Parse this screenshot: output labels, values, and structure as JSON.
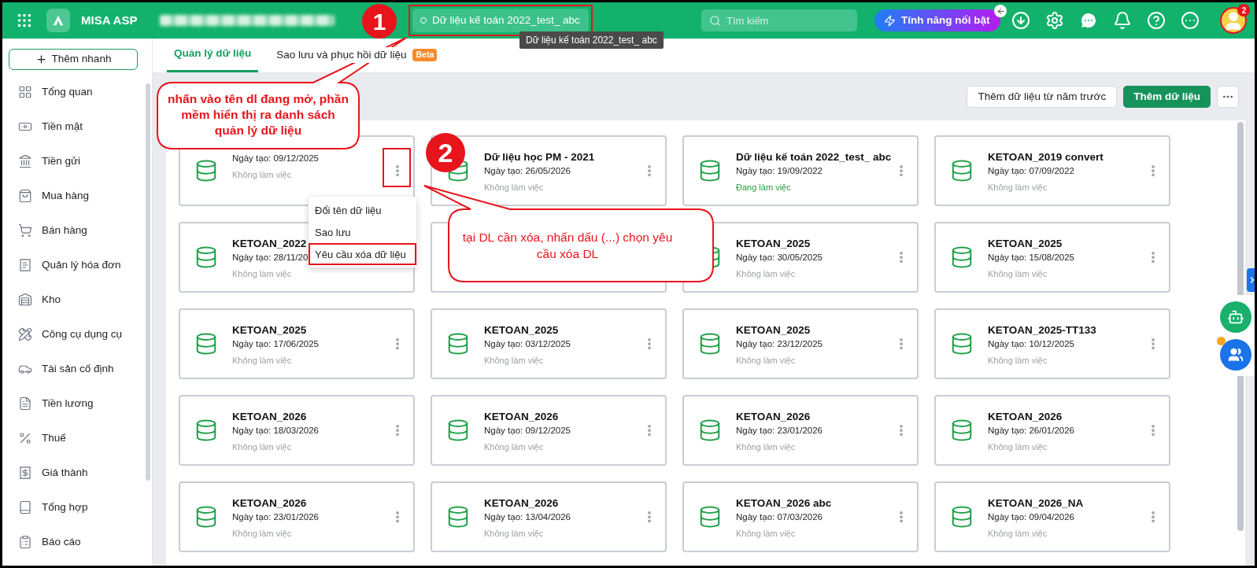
{
  "header": {
    "app_name": "MISA ASP",
    "current_data": "Dữ liệu kế toán 2022_test_ abc",
    "current_data_highlighted": true,
    "tooltip": "Dữ liệu kế toán 2022_test_ abc",
    "search": {
      "placeholder": "Tìm kiếm"
    },
    "feature_button": "Tính năng nổi bật",
    "notification_count": "2"
  },
  "sidebar": {
    "quick_add": "Thêm nhanh",
    "items": [
      {
        "label": "Tổng quan"
      },
      {
        "label": "Tiền mặt"
      },
      {
        "label": "Tiền gửi"
      },
      {
        "label": "Mua hàng"
      },
      {
        "label": "Bán hàng"
      },
      {
        "label": "Quản lý hóa đơn"
      },
      {
        "label": "Kho"
      },
      {
        "label": "Công cụ dụng cụ"
      },
      {
        "label": "Tài sản cố định"
      },
      {
        "label": "Tiền lương"
      },
      {
        "label": "Thuế"
      },
      {
        "label": "Giá thành"
      },
      {
        "label": "Tổng hợp"
      },
      {
        "label": "Báo cáo"
      }
    ]
  },
  "tabs": [
    {
      "label": "Quản lý dữ liệu",
      "selected": true
    },
    {
      "label": "Sao lưu và phục hồi dữ liệu",
      "selected": false,
      "badge": "Beta"
    }
  ],
  "toolbar": {
    "buttons": [
      {
        "kind": "outline",
        "label": "Thêm dữ liệu từ năm trước"
      },
      {
        "kind": "primary",
        "label": "Thêm dữ liệu"
      },
      {
        "kind": "more"
      }
    ]
  },
  "cards": [
    {
      "kind": "data",
      "date": "Ngày tạo: 09/12/2025",
      "status": "Không làm việc",
      "active": false,
      "highlighted": true
    },
    {
      "kind": "data",
      "title": "Dữ liệu học PM - 2021",
      "date": "Ngày tạo: 26/05/2026",
      "status": "Không làm việc",
      "active": false,
      "highlighted": false
    },
    {
      "kind": "data",
      "title": "Dữ liệu kế toán 2022_test_ abc",
      "date": "Ngày tạo: 19/09/2022",
      "status": "Đang làm việc",
      "active": true,
      "highlighted": false
    },
    {
      "kind": "data",
      "title": "KETOAN_2019 convert",
      "date": "Ngày tạo: 07/09/2022",
      "status": "Không làm việc",
      "active": false,
      "highlighted": false
    },
    {
      "kind": "data",
      "title": "KETOAN_2022",
      "date": "Ngày tạo: 28/11/20",
      "status": "Không làm việc",
      "active": false,
      "highlighted": false
    },
    {
      "kind": "covered"
    },
    {
      "kind": "data",
      "title": "KETOAN_2025",
      "date": "Ngày tạo: 30/05/2025",
      "status": "Không làm việc",
      "active": false,
      "highlighted": false
    },
    {
      "kind": "data",
      "title": "KETOAN_2025",
      "date": "Ngày tạo: 15/08/2025",
      "status": "Không làm việc",
      "active": false,
      "highlighted": false
    },
    {
      "kind": "data",
      "title": "KETOAN_2025",
      "date": "Ngày tạo: 17/06/2025",
      "status": "Không làm việc",
      "active": false,
      "highlighted": false
    },
    {
      "kind": "data",
      "title": "KETOAN_2025",
      "date": "Ngày tạo: 03/12/2025",
      "status": "Không làm việc",
      "active": false,
      "highlighted": false
    },
    {
      "kind": "data",
      "title": "KETOAN_2025",
      "date": "Ngày tạo: 23/12/2025",
      "status": "Không làm việc",
      "active": false,
      "highlighted": false
    },
    {
      "kind": "data",
      "title": "KETOAN_2025-TT133",
      "date": "Ngày tạo: 10/12/2025",
      "status": "Không làm việc",
      "active": false,
      "highlighted": false
    },
    {
      "kind": "data",
      "title": "KETOAN_2026",
      "date": "Ngày tạo: 18/03/2026",
      "status": "Không làm việc",
      "active": false,
      "highlighted": false
    },
    {
      "kind": "data",
      "title": "KETOAN_2026",
      "date": "Ngày tạo: 09/12/2025",
      "status": "Không làm việc",
      "active": false,
      "highlighted": false
    },
    {
      "kind": "data",
      "title": "KETOAN_2026",
      "date": "Ngày tạo: 23/01/2026",
      "status": "Không làm việc",
      "active": false,
      "highlighted": false
    },
    {
      "kind": "data",
      "title": "KETOAN_2026",
      "date": "Ngày tạo: 26/01/2026",
      "status": "Không làm việc",
      "active": false,
      "highlighted": false
    },
    {
      "kind": "data",
      "title": "KETOAN_2026",
      "date": "Ngày tạo: 23/01/2026",
      "status": "Không làm việc",
      "active": false,
      "highlighted": false
    },
    {
      "kind": "data",
      "title": "KETOAN_2026",
      "date": "Ngày tạo: 13/04/2026",
      "status": "Không làm việc",
      "active": false,
      "highlighted": false
    },
    {
      "kind": "data",
      "title": "KETOAN_2026 abc",
      "date": "Ngày tạo: 07/03/2026",
      "status": "Không làm việc",
      "active": false,
      "highlighted": false
    },
    {
      "kind": "data",
      "title": "KETOAN_2026_NA",
      "date": "Ngày tạo: 09/04/2026",
      "status": "Không làm việc",
      "active": false,
      "highlighted": false
    }
  ],
  "context_menu": {
    "items": [
      {
        "label": "Đổi tên dữ liệu",
        "highlighted": false
      },
      {
        "label": "Sao lưu",
        "highlighted": false
      },
      {
        "label": "Yêu cầu xóa dữ liệu",
        "highlighted": true
      }
    ]
  },
  "annotations": [
    {
      "number": "1",
      "text": "nhấn vào tên dl đang mở, phần mềm hiển thị ra danh sách quản lý dữ liệu"
    },
    {
      "number": "2",
      "text": "tại DL cần xóa, nhấn dấu (...) chọn yêu cầu xóa DL"
    }
  ]
}
